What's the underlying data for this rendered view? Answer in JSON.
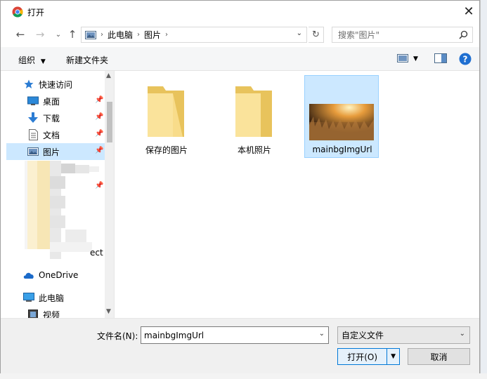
{
  "window": {
    "title": "打开",
    "close_icon": "close-icon"
  },
  "address": {
    "segments": [
      "此电脑",
      "图片"
    ],
    "search_placeholder": "搜索\"图片\""
  },
  "toolbar": {
    "organize_label": "组织",
    "new_folder_label": "新建文件夹"
  },
  "nav": {
    "items": [
      {
        "label": "快速访问",
        "icon": "star-icon",
        "pinned": false
      },
      {
        "label": "桌面",
        "icon": "desktop-icon",
        "pinned": true
      },
      {
        "label": "下载",
        "icon": "download-icon",
        "pinned": true
      },
      {
        "label": "文档",
        "icon": "document-icon",
        "pinned": true
      },
      {
        "label": "图片",
        "icon": "pictures-icon",
        "pinned": true,
        "selected": true
      },
      {
        "label": "OneDrive",
        "icon": "onedrive-icon",
        "pinned": false
      },
      {
        "label": "此电脑",
        "icon": "computer-icon",
        "pinned": false
      },
      {
        "label": "视频",
        "icon": "video-icon",
        "pinned": false
      }
    ],
    "partial_text": "ect"
  },
  "files": [
    {
      "name": "保存的图片",
      "type": "folder",
      "selected": false
    },
    {
      "name": "本机照片",
      "type": "folder",
      "selected": false
    },
    {
      "name": "mainbgImgUrl",
      "type": "image",
      "selected": true
    }
  ],
  "footer": {
    "filename_label": "文件名(N):",
    "filename_value": "mainbgImgUrl",
    "filetype_value": "自定义文件",
    "open_label": "打开(O)",
    "cancel_label": "取消"
  },
  "colors": {
    "selection": "#cce8ff",
    "accent": "#0078d7",
    "folder": "#f5d67a"
  }
}
